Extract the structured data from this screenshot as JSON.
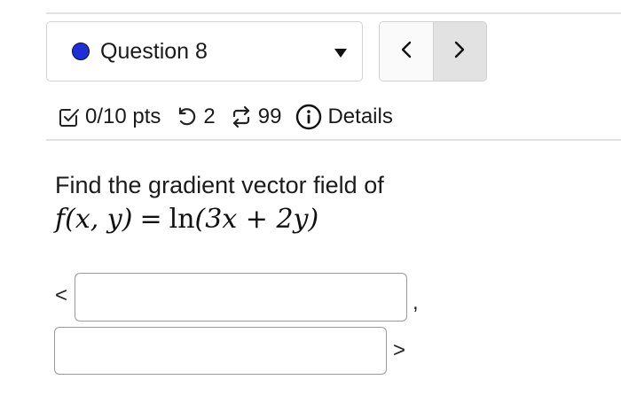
{
  "header": {
    "question_label": "Question 8",
    "status_dot_color": "#1f2fd6",
    "nav": {
      "prev_label": "<",
      "next_label": ">"
    }
  },
  "info": {
    "points": "0/10 pts",
    "attempts": "2",
    "submissions": "99",
    "details_label": "Details"
  },
  "question": {
    "prompt": "Find the gradient vector field of",
    "formula": {
      "fn": "f",
      "args": "(x, y)",
      "equals": "=",
      "rhs_fn": "ln",
      "rhs_args": "(3x + 2y)"
    }
  },
  "answer": {
    "open_bracket": "<",
    "comma": ",",
    "close_bracket": ">",
    "field_1_value": "",
    "field_2_value": ""
  },
  "icons": [
    "checkbox-icon",
    "retry-icon",
    "repeat-icon",
    "info-icon",
    "caret-down-icon"
  ]
}
